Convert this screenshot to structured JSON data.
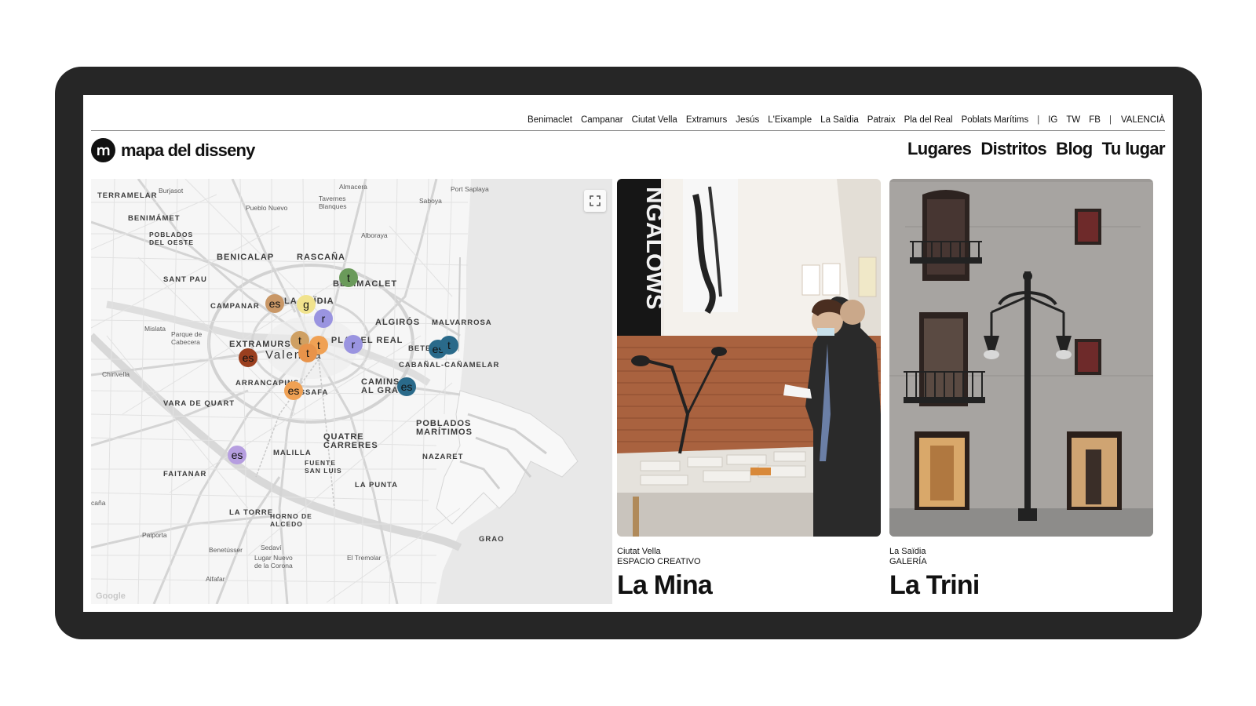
{
  "top_nav": {
    "districts": [
      "Benimaclet",
      "Campanar",
      "Ciutat Vella",
      "Extramurs",
      "Jesús",
      "L'Eixample",
      "La Saïdia",
      "Patraix",
      "Pla del Real",
      "Poblats Marítims"
    ],
    "separator": "|",
    "social": [
      "IG",
      "TW",
      "FB"
    ],
    "city": "VALENCIÀ"
  },
  "logo": {
    "mark": "m",
    "text": "mapa del disseny"
  },
  "main_nav": [
    "Lugares",
    "Distritos",
    "Blog",
    "Tu lugar"
  ],
  "map": {
    "attribution": "Google",
    "labels": {
      "terramelar": "TERRAMELAR",
      "burjassot": "Burjasot",
      "almacera": "Almacera",
      "port_saplaya": "Port Saplaya",
      "benimamet": "BENIMÁMET",
      "pueblo_nuevo": "Pueblo Nuevo",
      "tavernes": "Tavernes\nBlanques",
      "saboya": "Saboya",
      "poblados_oeste": "POBLADOS\nDEL OESTE",
      "alboraya": "Alboraya",
      "benicalap": "BENICALAP",
      "rascana": "RASCAÑA",
      "sant_pau": "SANT PAU",
      "benimaclet": "BENIMACLET",
      "campanar": "CAMPANAR",
      "saidia": "LA SAÏDIA",
      "mislata": "Mislata",
      "parque_cabecera": "Parque de\nCabecera",
      "algiros": "ALGIRÓS",
      "malvarrosa": "MALVARROSA",
      "extramurs": "EXTRAMURS",
      "pla_real": "EL PLA DEL REAL",
      "benetusser_area": "BETERÓ",
      "valencia": "Valencia",
      "cabanal": "CABAÑAL-CAÑAMELAR",
      "chirivella": "Chirivella",
      "arrancapins": "ARRANCAPINS",
      "russafa": "RUSSAFA",
      "camins": "CAMINS\nAL GRAO",
      "vara_quart": "VARA DE QUART",
      "poblados_maritimos": "POBLADOS\nMARÍTIMOS",
      "quatre_carreres": "QUATRE\nCARRERES",
      "malilla": "MALILLA",
      "nazaret": "NAZARET",
      "faitanar": "FAITANAR",
      "fuente_luis": "FUENTE\nSAN LUIS",
      "la_punta": "LA PUNTA",
      "la_torre": "LA TORRE",
      "horno_alcedo": "HORNO DE\nALCEDO",
      "paiporta": "Paiporta",
      "grao": "GRAO",
      "sedavi": "Sedaví",
      "benetusser": "Benetússer",
      "lugar_nuevo": "Lugar Nuevo\nde la Corona",
      "el_tremolar": "El Tremolar",
      "alfafar": "Alfafar",
      "cana": "caña"
    },
    "pins": [
      {
        "label": "t",
        "color": "#6a9a5a"
      },
      {
        "label": "es",
        "color": "#c99766"
      },
      {
        "label": "g",
        "color": "#f1e38d"
      },
      {
        "label": "r",
        "color": "#9a94e0"
      },
      {
        "label": "t",
        "color": "#cfa063"
      },
      {
        "label": "t",
        "color": "#f0a154"
      },
      {
        "label": "t",
        "color": "#e8934a"
      },
      {
        "label": "r",
        "color": "#9a94e0"
      },
      {
        "label": "es",
        "color": "#9a3f1f"
      },
      {
        "label": "es",
        "color": "#f0a154"
      },
      {
        "label": "es",
        "color": "#2a6a8a"
      },
      {
        "label": "t",
        "color": "#2a6a8a"
      },
      {
        "label": "es",
        "color": "#2a6a8a"
      },
      {
        "label": "es",
        "color": "#b69ee0"
      }
    ]
  },
  "cards": [
    {
      "district": "Ciutat Vella",
      "category": "ESPACIO CREATIVO",
      "title": "La Mina",
      "banner_text": "NGALOWS"
    },
    {
      "district": "La Saïdia",
      "category": "GALERÍA",
      "title": "La Trini"
    }
  ],
  "colors": {
    "frame": "#262626",
    "text": "#111111",
    "map_bg": "#f5f5f5",
    "sea": "#e9e9e9"
  }
}
